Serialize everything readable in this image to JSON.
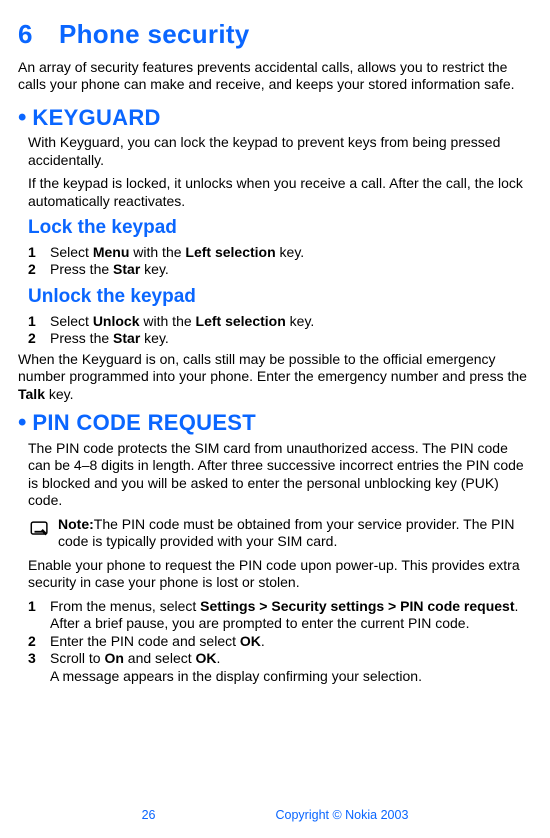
{
  "chapter": {
    "number": "6",
    "title": "Phone security"
  },
  "intro": "An array of security features prevents accidental calls, allows you to restrict the calls your phone can make and receive, and keeps your stored information safe.",
  "keyguard": {
    "bullet": "•",
    "title": "KEYGUARD",
    "p1": "With Keyguard, you can lock the keypad to prevent keys from being pressed accidentally.",
    "p2": "If the keypad is locked, it unlocks when you receive a call. After the call, the lock automatically reactivates.",
    "lock": {
      "heading": "Lock the keypad",
      "s1_num": "1",
      "s1_a": "Select ",
      "s1_b": "Menu",
      "s1_c": " with the ",
      "s1_d": "Left selection",
      "s1_e": " key.",
      "s2_num": "2",
      "s2_a": "Press the ",
      "s2_b": "Star",
      "s2_c": " key."
    },
    "unlock": {
      "heading": "Unlock the keypad",
      "s1_num": "1",
      "s1_a": "Select ",
      "s1_b": "Unlock",
      "s1_c": " with the ",
      "s1_d": "Left selection",
      "s1_e": " key.",
      "s2_num": "2",
      "s2_a": "Press the ",
      "s2_b": "Star",
      "s2_c": " key.",
      "after_a": "When the Keyguard is on, calls still may be possible to the official emergency number programmed into your phone. Enter the emergency number and press the ",
      "after_b": "Talk",
      "after_c": " key."
    }
  },
  "pin": {
    "bullet": "•",
    "title": "PIN CODE REQUEST",
    "p1": "The PIN code protects the SIM card from unauthorized access. The PIN code can be 4–8 digits in length. After three successive incorrect entries the PIN code is blocked and you will be asked to enter the personal unblocking key (PUK) code.",
    "note_label": "Note:",
    "note_text": "The PIN code must be obtained from your service provider. The PIN code is typically provided with your SIM card.",
    "p2": "Enable your phone to request the PIN code upon power-up. This provides extra security in case your phone is lost or stolen.",
    "s1_num": "1",
    "s1_a": "From the menus, select ",
    "s1_b": "Settings > Security settings > PIN code request",
    "s1_c": ".",
    "s1_tail": "After a brief pause, you are prompted to enter the current PIN code.",
    "s2_num": "2",
    "s2_a": "Enter the PIN code and select ",
    "s2_b": "OK",
    "s2_c": ".",
    "s3_num": "3",
    "s3_a": "Scroll to ",
    "s3_b": "On",
    "s3_c": " and select ",
    "s3_d": "OK",
    "s3_e": ".",
    "s3_tail": "A message appears in the display confirming your selection."
  },
  "footer": {
    "page": "26",
    "copyright": "Copyright © Nokia 2003"
  }
}
